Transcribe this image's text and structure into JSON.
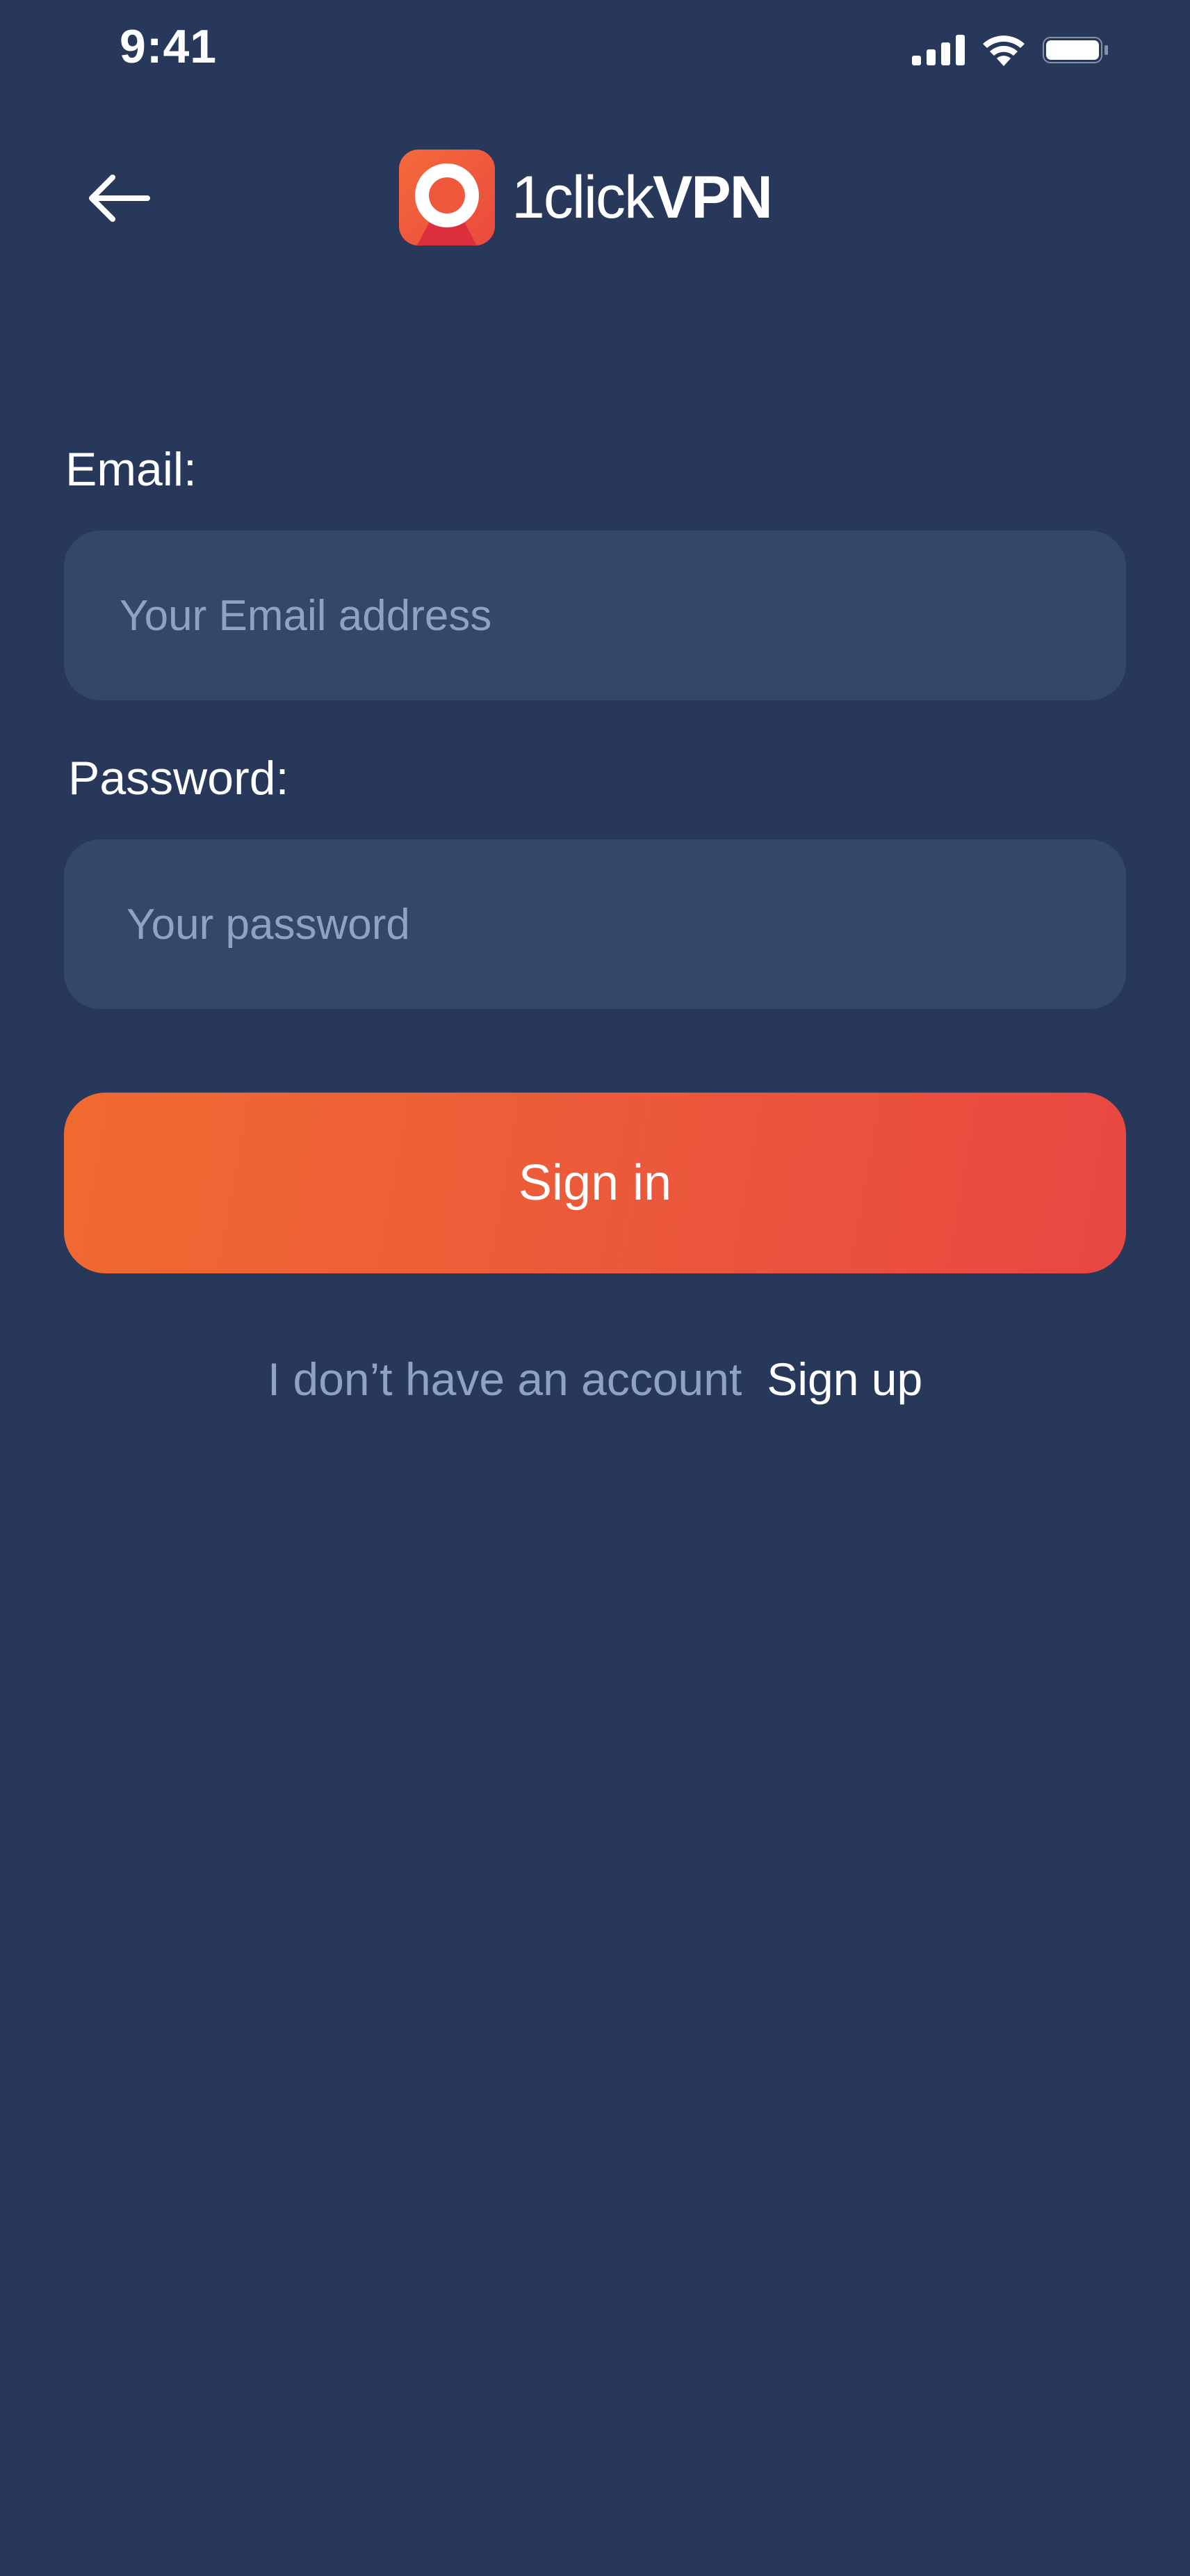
{
  "status_bar": {
    "time": "9:41",
    "icons": [
      "signal-icon",
      "wifi-icon",
      "battery-icon"
    ]
  },
  "header": {
    "back_icon": "arrow-left-icon",
    "logo": {
      "wordmark_light": "1click",
      "wordmark_bold": "VPN"
    }
  },
  "form": {
    "email": {
      "label": "Email:",
      "placeholder": "Your Email address",
      "value": ""
    },
    "password": {
      "label": "Password:",
      "placeholder": "Your password",
      "value": ""
    },
    "submit_label": "Sign in"
  },
  "footer": {
    "prompt": "I don’t have an account",
    "link": "Sign up"
  },
  "colors": {
    "background": "#27385a",
    "input_background": "#33476b",
    "placeholder": "#8fa1c4",
    "accent_start": "#f06a30",
    "accent_end": "#e84742",
    "text": "#ffffff"
  }
}
